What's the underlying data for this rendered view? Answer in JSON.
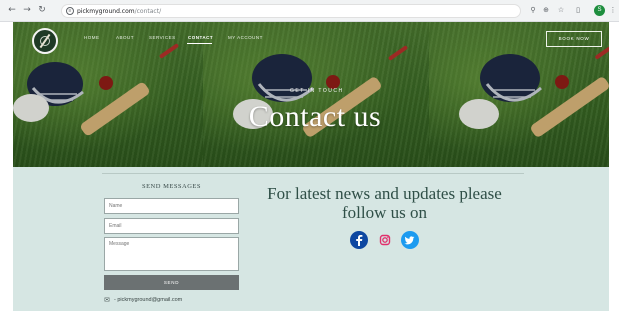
{
  "browser": {
    "url_domain": "pickmyground.com",
    "url_path": "/contact/",
    "back_icon": "arrow-left-icon",
    "forward_icon": "arrow-right-icon",
    "reload_icon": "reload-icon",
    "profile_initial": "S"
  },
  "site": {
    "nav": {
      "home": "HOME",
      "about": "ABOUT",
      "services": "SERVICES",
      "contact": "CONTACT",
      "my_account": "MY ACCOUNT",
      "book_now": "BOOK NOW"
    },
    "hero": {
      "kicker": "GET IN TOUCH",
      "title": "Contact us"
    },
    "form": {
      "heading": "SEND MESSAGES",
      "name_placeholder": "Name",
      "email_placeholder": "Email",
      "message_placeholder": "Message",
      "send_label": "SEND"
    },
    "contact_email": "- pickmyground@gmail.com",
    "follow_text": "For latest news and updates please follow us on",
    "social_icons": [
      "facebook-icon",
      "instagram-icon",
      "twitter-icon"
    ]
  },
  "colors": {
    "page_background": "#d6e6e3",
    "follow_text": "#2f4f47",
    "send_button": "#6b7172",
    "facebook": "#0d47a1",
    "instagram": "#e1306c",
    "twitter": "#1d9bf0"
  }
}
